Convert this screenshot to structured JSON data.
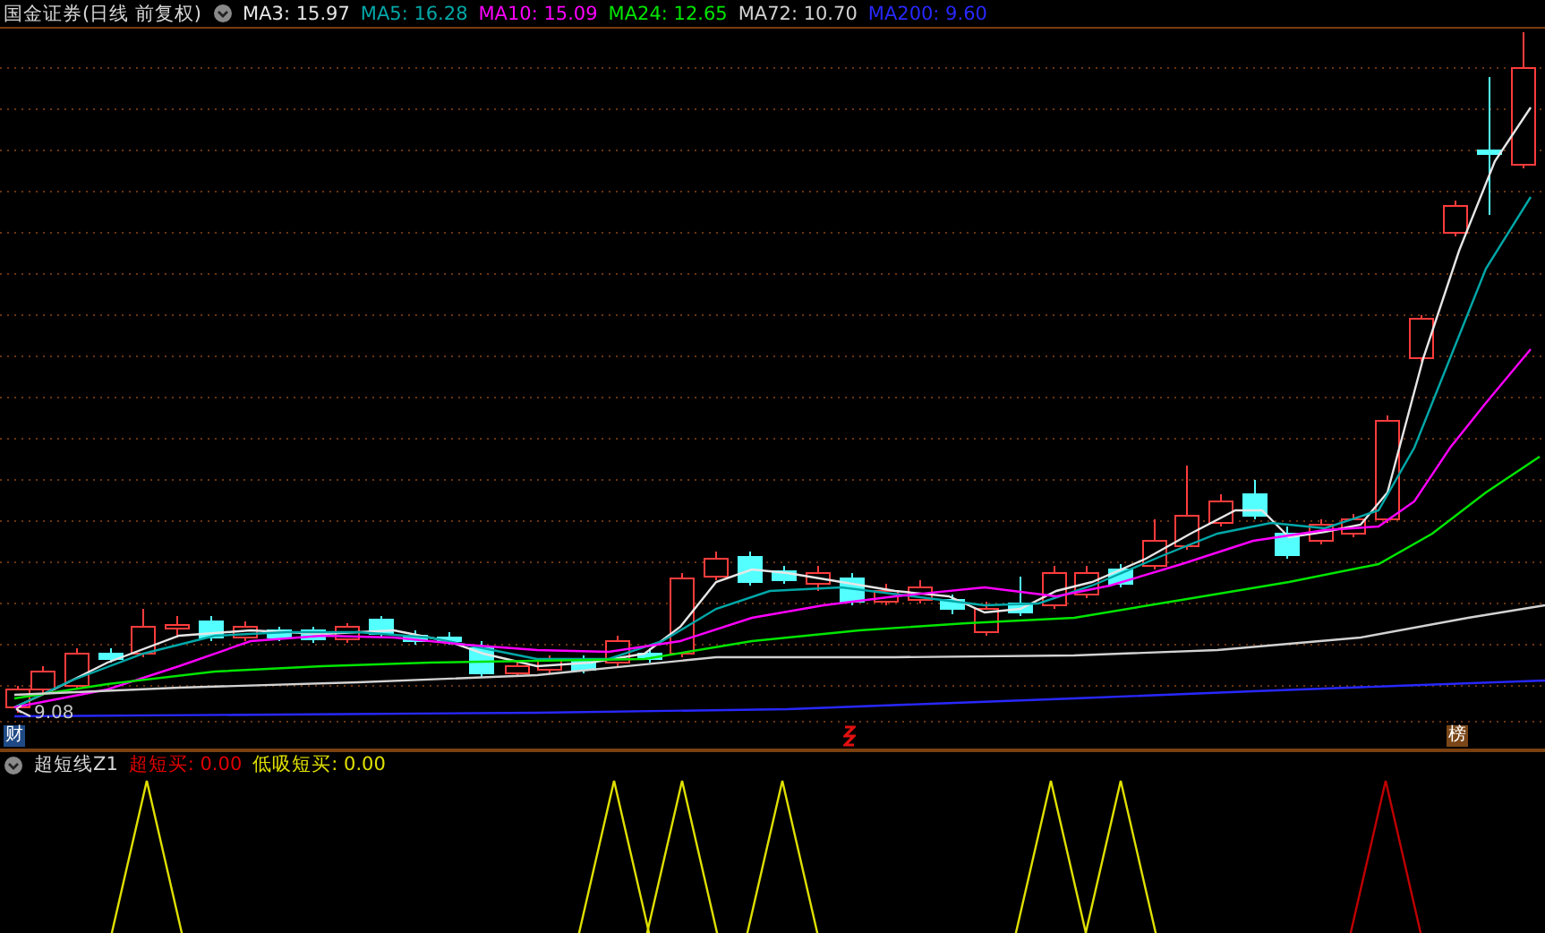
{
  "header": {
    "title": "国金证券(日线 前复权)",
    "moving_averages": [
      {
        "label": "MA3: 15.97",
        "color": "#e6e6e6"
      },
      {
        "label": "MA5: 16.28",
        "color": "#00a8a8"
      },
      {
        "label": "MA10: 15.09",
        "color": "#ff00ff"
      },
      {
        "label": "MA24: 12.65",
        "color": "#00e600"
      },
      {
        "label": "MA72: 10.70",
        "color": "#d2d2d2"
      },
      {
        "label": "MA200: 9.60",
        "color": "#2828ff"
      }
    ]
  },
  "main_chart": {
    "low_price_label": "9.08"
  },
  "event_markers": [
    {
      "label": "财",
      "color": "#1f4a86"
    },
    {
      "label": "榜",
      "color": "#7a4618"
    }
  ],
  "indicator": {
    "name": "超短线Z1",
    "readings": [
      {
        "label": "超短买: 0.00",
        "color": "#e00000"
      },
      {
        "label": "低吸短买: 0.00",
        "color": "#e0e000"
      }
    ]
  }
}
